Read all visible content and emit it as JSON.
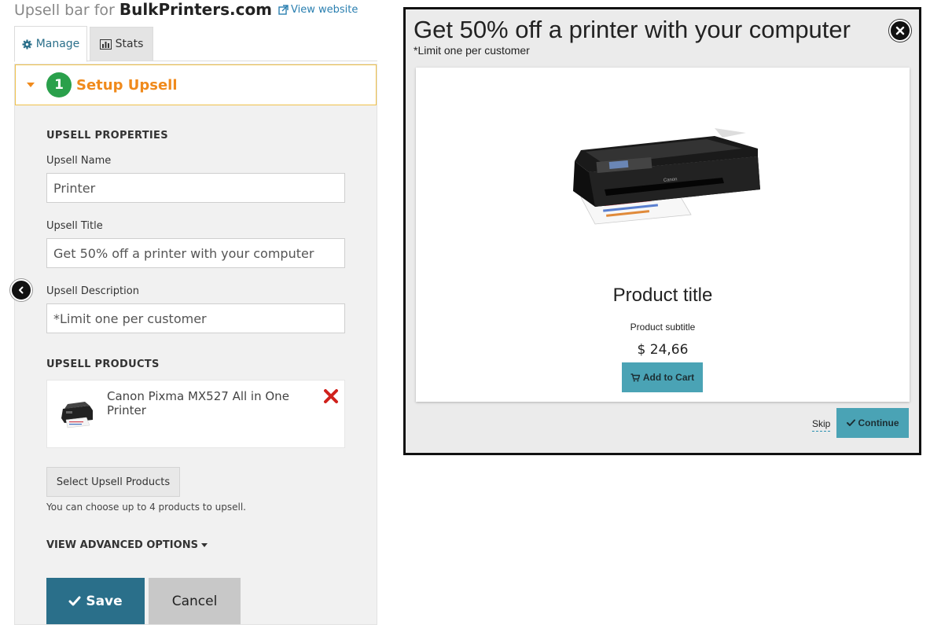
{
  "header": {
    "prefix": "Upsell bar for",
    "site_name": "BulkPrinters.com",
    "view_link": "View website"
  },
  "tabs": [
    {
      "label": "Manage",
      "icon": "gear-icon",
      "active": true
    },
    {
      "label": "Stats",
      "icon": "bar-chart-icon",
      "active": false
    }
  ],
  "section": {
    "step": "1",
    "title": "Setup Upsell"
  },
  "properties": {
    "heading": "UPSELL PROPERTIES",
    "name_label": "Upsell Name",
    "name_value": "Printer",
    "title_label": "Upsell Title",
    "title_value": "Get 50% off a printer with your computer",
    "description_label": "Upsell Description",
    "description_value": "*Limit one per customer"
  },
  "products": {
    "heading": "UPSELL PRODUCTS",
    "items": [
      {
        "name": "Canon Pixma MX527 All in One Printer"
      }
    ],
    "select_button": "Select Upsell Products",
    "hint": "You can choose up to 4 products to upsell.",
    "advanced_label": "VIEW ADVANCED OPTIONS"
  },
  "actions": {
    "save": "Save",
    "cancel": "Cancel"
  },
  "preview": {
    "title": "Get 50% off a printer with your computer",
    "subtitle": "*Limit one per customer",
    "product_title": "Product title",
    "product_subtitle": "Product subtitle",
    "price": "$ 24,66",
    "add_to_cart": "Add to Cart",
    "skip": "Skip",
    "continue": "Continue"
  },
  "colors": {
    "accent_orange": "#f08a1c",
    "step_green": "#2aa04b",
    "save_blue": "#2a6f8a",
    "preview_button": "#4aa3b5",
    "remove_red": "#d0211c"
  }
}
